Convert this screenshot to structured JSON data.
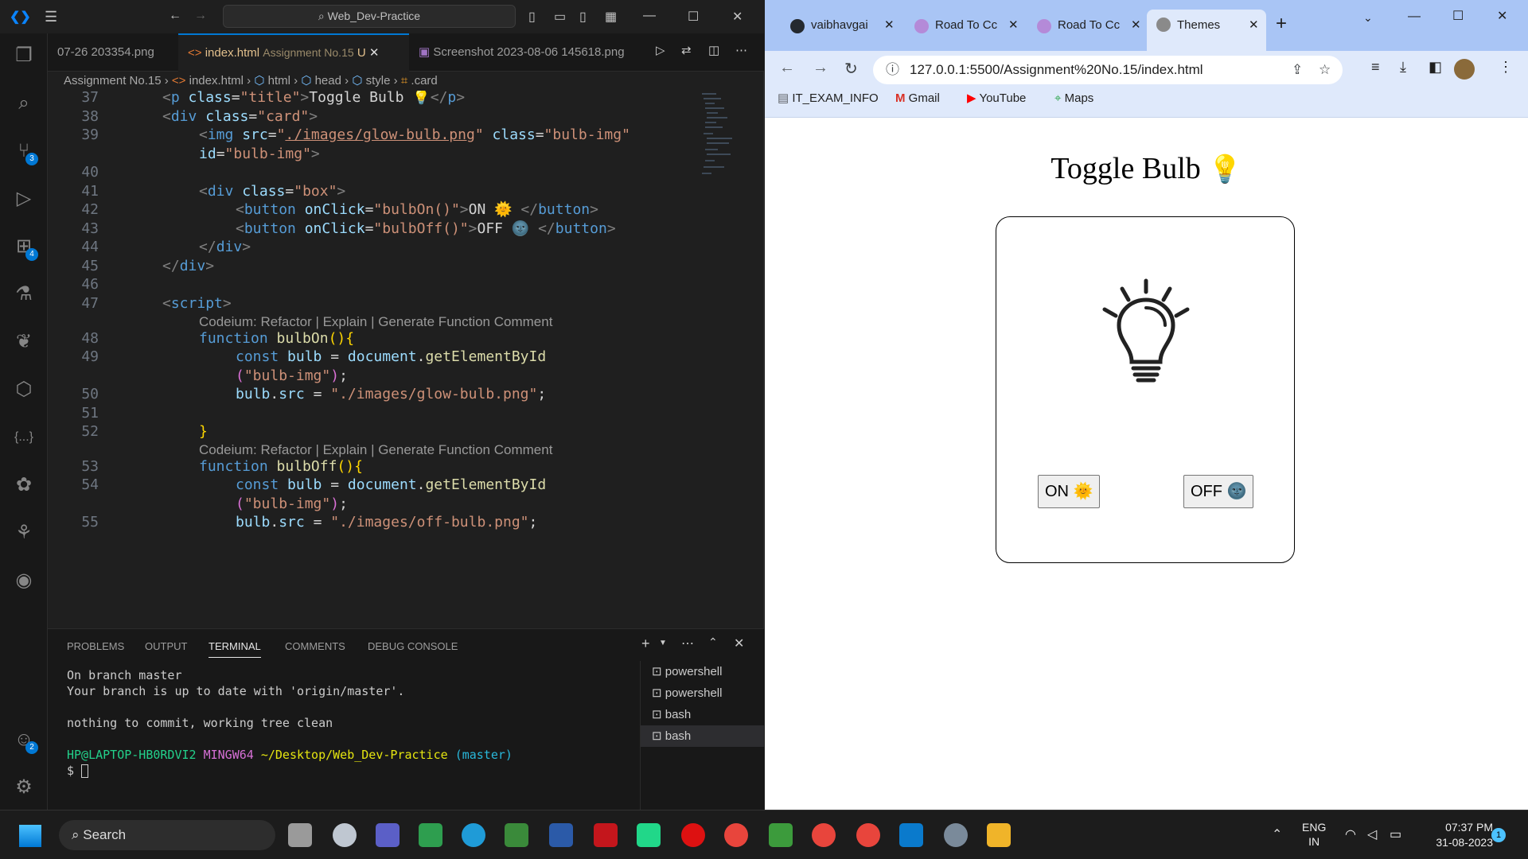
{
  "vscode": {
    "search_text": "Web_Dev-Practice",
    "tabs": [
      {
        "label": "07-26 203354.png"
      },
      {
        "label": "index.html",
        "detail": "Assignment No.15",
        "status": "U"
      },
      {
        "label": "Screenshot 2023-08-06 145618.png"
      }
    ],
    "breadcrumb": [
      "Assignment No.15",
      "index.html",
      "html",
      "head",
      "style",
      ".card"
    ],
    "activity_badges": {
      "scm": "3",
      "extensions": "4",
      "accounts": "2"
    },
    "code_lens": "Codeium: Refactor | Explain | Generate Function Comment",
    "line_numbers": [
      "37",
      "38",
      "39",
      "40",
      "41",
      "42",
      "43",
      "44",
      "45",
      "46",
      "47",
      "48",
      "49",
      "50",
      "51",
      "52",
      "53",
      "54",
      "55"
    ],
    "panel_tabs": [
      "PROBLEMS",
      "OUTPUT",
      "TERMINAL",
      "COMMENTS",
      "DEBUG CONSOLE"
    ],
    "terminal": {
      "line1": "On branch master",
      "line2": "Your branch is up to date with 'origin/master'.",
      "line3": "nothing to commit, working tree clean",
      "user": "HP@LAPTOP-HB0RDVI2",
      "env": "MINGW64",
      "path": "~/Desktop/Web_Dev-Practice",
      "branch": "(master)",
      "prompt": "$"
    },
    "terminal_list": [
      "powershell",
      "powershell",
      "bash",
      "bash"
    ]
  },
  "browser": {
    "tabs": [
      "vaibhavgai",
      "Road To Cc",
      "Road To Cc",
      "Themes"
    ],
    "url": "127.0.0.1:5500/Assignment%20No.15/index.html",
    "bookmarks": [
      "IT_EXAM_INFO",
      "Gmail",
      "YouTube",
      "Maps"
    ],
    "page": {
      "title": "Toggle Bulb",
      "on_label": "ON",
      "off_label": "OFF"
    }
  },
  "taskbar": {
    "search_label": "Search",
    "lang1": "ENG",
    "lang2": "IN",
    "time": "07:37 PM",
    "date": "31-08-2023",
    "notif_count": "1"
  }
}
